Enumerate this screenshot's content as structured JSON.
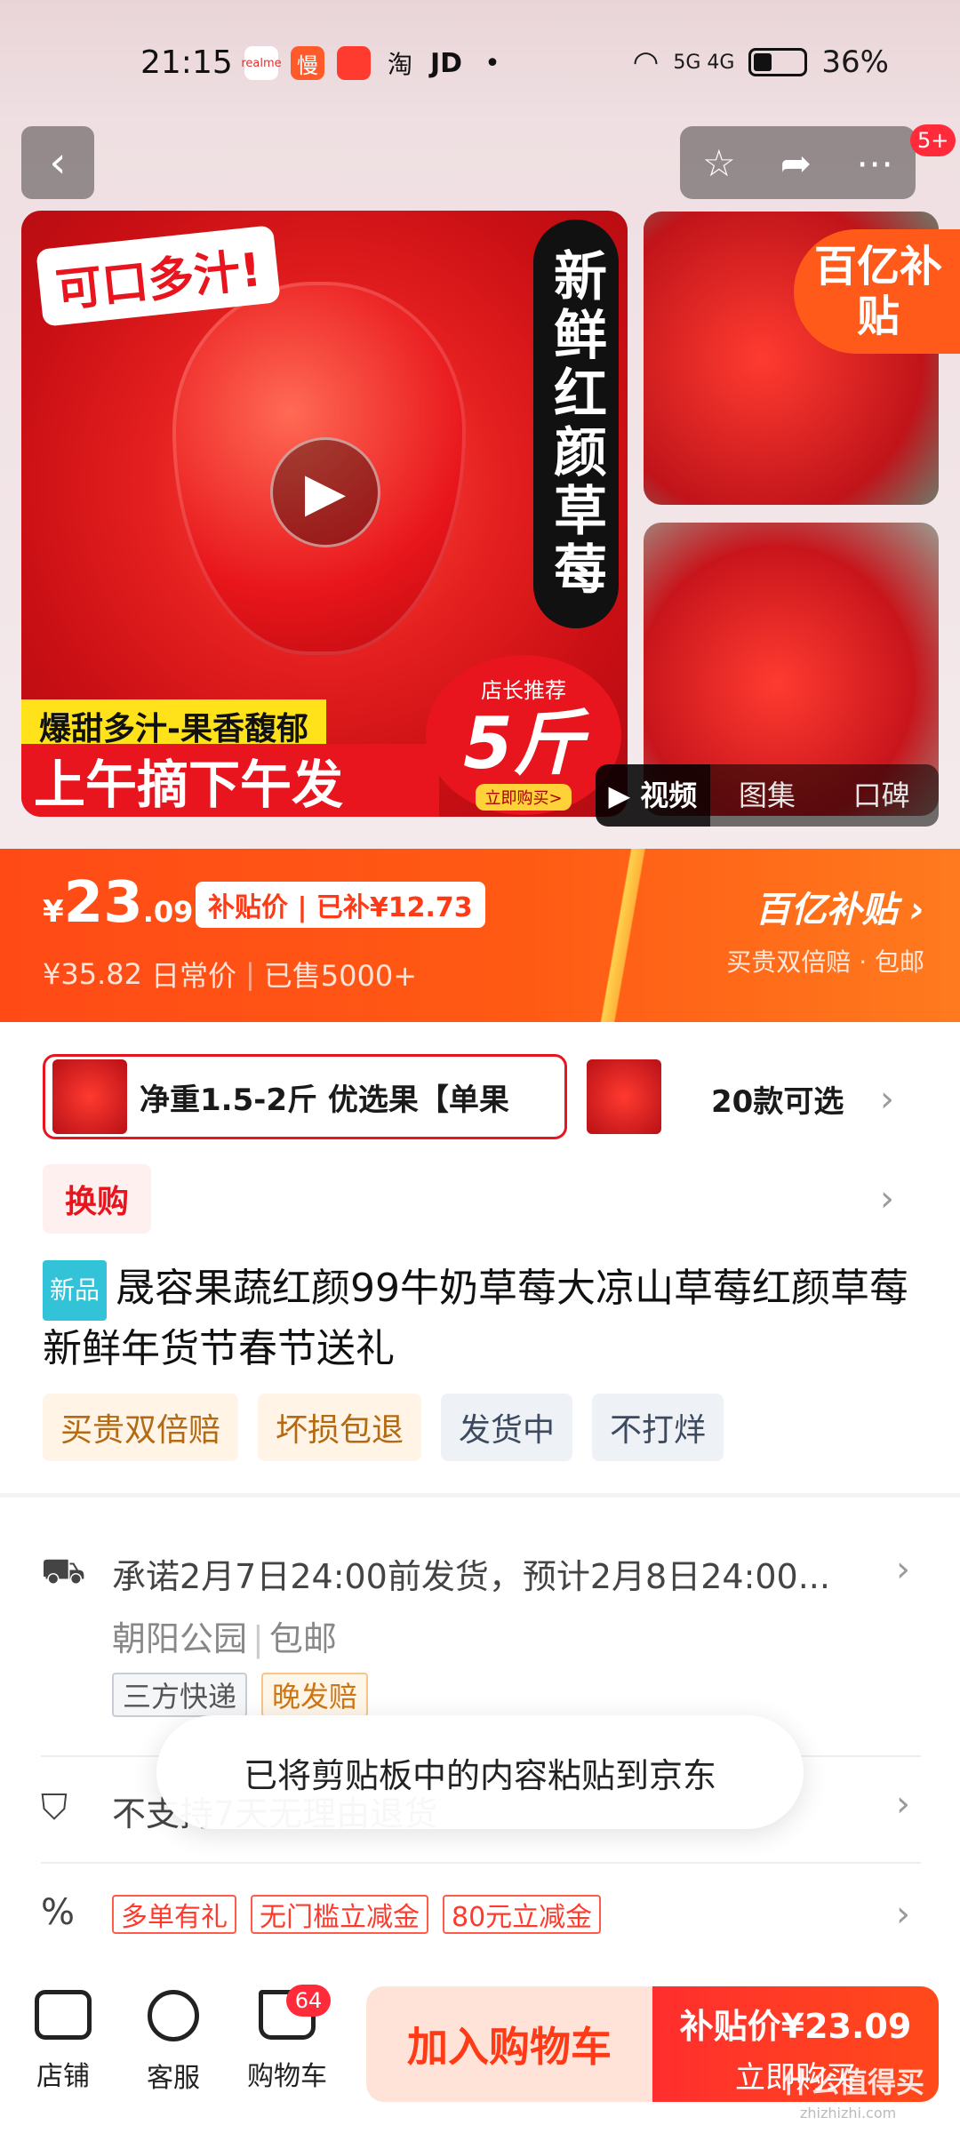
{
  "status_bar": {
    "time": "21:15",
    "apps": [
      "realme",
      "慢",
      "",
      "淘",
      "JD",
      "•"
    ],
    "network": "5G 4G",
    "battery": "36%"
  },
  "nav": {
    "back_icon": "chevron-left-icon",
    "actions": [
      "star-icon",
      "share-icon",
      "more-icon"
    ],
    "notification_count": "5+"
  },
  "gallery": {
    "headline": "可口多汁!",
    "vertical_title": "新鲜红颜草莓",
    "sub_banner": "爆甜多汁-果香馥郁",
    "main_banner": "上午摘下午发",
    "recommend_top": "店长推荐",
    "recommend_big": "5斤",
    "recommend_btn": "立即购买>",
    "subsidy_badge": "百亿补贴",
    "tabs": [
      "▶ 视频",
      "图集",
      "口碑"
    ]
  },
  "price": {
    "currency": "¥",
    "integer": "23",
    "decimal": ".09",
    "subsidy_tag": "补贴价 | 已补¥12.73",
    "original": "¥35.82",
    "original_label": "日常价",
    "sold": "已售5000+",
    "brand": "百亿补贴 ›",
    "brand_sub": "买贵双倍赔 · 包邮"
  },
  "sku": {
    "selected": "净重1.5-2斤 优选果【单果",
    "count": "20款可选"
  },
  "swap": "换购",
  "product": {
    "new_badge": "新品",
    "title": "晟容果蔬红颜99牛奶草莓大凉山草莓红颜草莓新鲜年货节春节送礼",
    "service_tags": [
      "买贵双倍赔",
      "坏损包退",
      "发货中",
      "不打烊"
    ]
  },
  "shipping": {
    "promise": "承诺2月7日24:00前发货，预计2月8日24:00...",
    "origin": "朝阳公园",
    "free_shipping": "包邮",
    "tags": [
      "三方快递",
      "晚发赔"
    ],
    "return_policy": "不支持7天无理由退货",
    "promos": [
      "多单有礼",
      "无门槛立减金",
      "80元立减金"
    ]
  },
  "toast": "已将剪贴板中的内容粘贴到京东",
  "bottom": {
    "store": "店铺",
    "service": "客服",
    "cart": "购物车",
    "cart_count": "64",
    "add_to_cart": "加入购物车",
    "buy_price": "补贴价¥23.09",
    "buy_now": "立即购买"
  },
  "watermark": "什么值得买",
  "watermark_sub": "zhizhizhi.com"
}
